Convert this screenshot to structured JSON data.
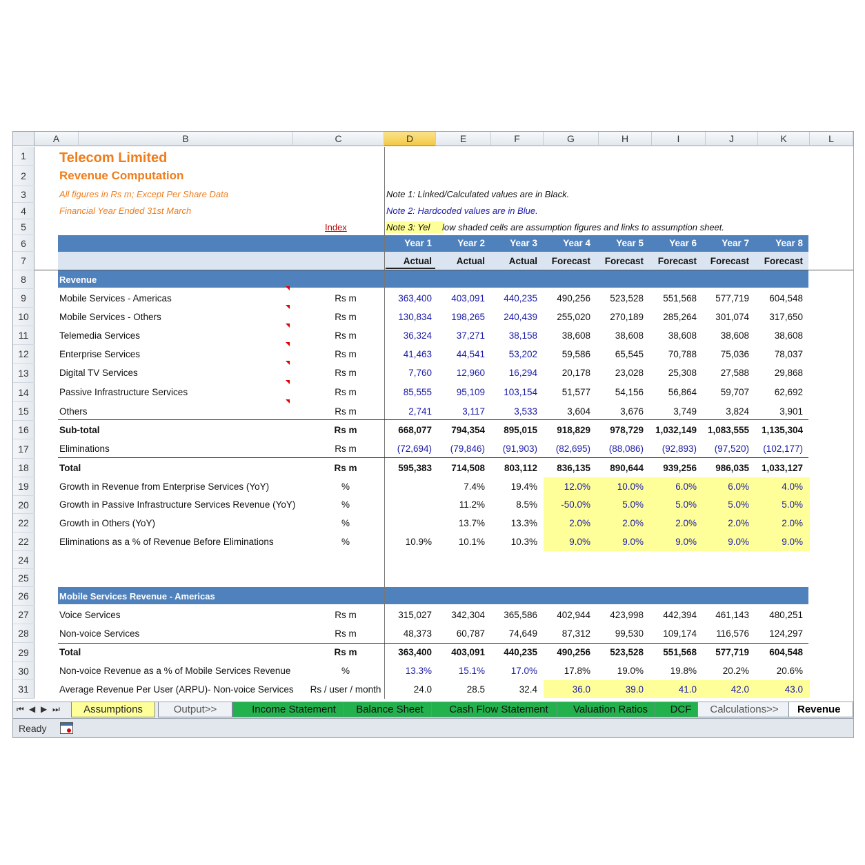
{
  "columns": [
    "A",
    "B",
    "C",
    "D",
    "E",
    "F",
    "G",
    "H",
    "I",
    "J",
    "K",
    "L"
  ],
  "selected_column": "D",
  "header": {
    "title": "Telecom Limited",
    "subtitle": "Revenue Computation",
    "units_note": "All figures in Rs m; Except Per Share Data",
    "fy_note": "Financial Year Ended 31st March",
    "index_link": "Index",
    "note1": "Note 1: Linked/Calculated values are in Black.",
    "note2": "Note 2: Hardcoded values are in Blue.",
    "note3_highlight": "Note 3: Yel",
    "note3_rest": "low shaded cells are assumption figures and links to assumption sheet."
  },
  "years": [
    "Year 1",
    "Year 2",
    "Year 3",
    "Year 4",
    "Year 5",
    "Year 6",
    "Year 7",
    "Year 8"
  ],
  "periods": [
    "Actual",
    "Actual",
    "Actual",
    "Forecast",
    "Forecast",
    "Forecast",
    "Forecast",
    "Forecast"
  ],
  "section1": {
    "title": "Revenue",
    "rows": [
      {
        "num": "9",
        "label": "Mobile Services - Americas",
        "unit": "Rs m",
        "values": [
          "363,400",
          "403,091",
          "440,235",
          "490,256",
          "523,528",
          "551,568",
          "577,719",
          "604,548"
        ]
      },
      {
        "num": "10",
        "label": "Mobile Services - Others",
        "unit": "Rs m",
        "values": [
          "130,834",
          "198,265",
          "240,439",
          "255,020",
          "270,189",
          "285,264",
          "301,074",
          "317,650"
        ]
      },
      {
        "num": "11",
        "label": "Telemedia Services",
        "unit": "Rs m",
        "values": [
          "36,324",
          "37,271",
          "38,158",
          "38,608",
          "38,608",
          "38,608",
          "38,608",
          "38,608"
        ]
      },
      {
        "num": "12",
        "label": "Enterprise Services",
        "unit": "Rs m",
        "values": [
          "41,463",
          "44,541",
          "53,202",
          "59,586",
          "65,545",
          "70,788",
          "75,036",
          "78,037"
        ]
      },
      {
        "num": "13",
        "label": "Digital TV Services",
        "unit": "Rs m",
        "values": [
          "7,760",
          "12,960",
          "16,294",
          "20,178",
          "23,028",
          "25,308",
          "27,588",
          "29,868"
        ]
      },
      {
        "num": "14",
        "label": "Passive Infrastructure Services",
        "unit": "Rs m",
        "values": [
          "85,555",
          "95,109",
          "103,154",
          "51,577",
          "54,156",
          "56,864",
          "59,707",
          "62,692"
        ]
      },
      {
        "num": "15",
        "label": "Others",
        "unit": "Rs m",
        "values": [
          "2,741",
          "3,117",
          "3,533",
          "3,604",
          "3,676",
          "3,749",
          "3,824",
          "3,901"
        ]
      }
    ],
    "subtotal": {
      "num": "16",
      "label": "Sub-total",
      "unit": "Rs m",
      "values": [
        "668,077",
        "794,354",
        "895,015",
        "918,829",
        "978,729",
        "1,032,149",
        "1,083,555",
        "1,135,304"
      ]
    },
    "eliminations": {
      "num": "17",
      "label": "Eliminations",
      "unit": "Rs m",
      "values": [
        "(72,694)",
        "(79,846)",
        "(91,903)",
        "(82,695)",
        "(88,086)",
        "(92,893)",
        "(97,520)",
        "(102,177)"
      ]
    },
    "total": {
      "num": "18",
      "label": "Total",
      "unit": "Rs m",
      "values": [
        "595,383",
        "714,508",
        "803,112",
        "836,135",
        "890,644",
        "939,256",
        "986,035",
        "1,033,127"
      ]
    },
    "ratios": [
      {
        "num": "19",
        "label": "Growth in Revenue from Enterprise Services (YoY)",
        "unit": "%",
        "values": [
          "",
          "7.4%",
          "19.4%",
          "12.0%",
          "10.0%",
          "6.0%",
          "6.0%",
          "4.0%"
        ]
      },
      {
        "num": "20",
        "label": "Growth in Passive Infrastructure Services Revenue (YoY)",
        "unit": "%",
        "values": [
          "",
          "11.2%",
          "8.5%",
          "-50.0%",
          "5.0%",
          "5.0%",
          "5.0%",
          "5.0%"
        ]
      },
      {
        "num": "22",
        "label": "Growth in Others (YoY)",
        "unit": "%",
        "values": [
          "",
          "13.7%",
          "13.3%",
          "2.0%",
          "2.0%",
          "2.0%",
          "2.0%",
          "2.0%"
        ]
      },
      {
        "num": "22",
        "label": "Eliminations as a % of Revenue Before Eliminations",
        "unit": "%",
        "values": [
          "10.9%",
          "10.1%",
          "10.3%",
          "9.0%",
          "9.0%",
          "9.0%",
          "9.0%",
          "9.0%"
        ]
      }
    ]
  },
  "blank_rows": [
    "24",
    "25"
  ],
  "section2": {
    "num": "26",
    "title": "Mobile Services Revenue - Americas",
    "rows": [
      {
        "num": "27",
        "label": "Voice Services",
        "unit": "Rs m",
        "values": [
          "315,027",
          "342,304",
          "365,586",
          "402,944",
          "423,998",
          "442,394",
          "461,143",
          "480,251"
        ]
      },
      {
        "num": "28",
        "label": "Non-voice Services",
        "unit": "Rs m",
        "values": [
          "48,373",
          "60,787",
          "74,649",
          "87,312",
          "99,530",
          "109,174",
          "116,576",
          "124,297"
        ]
      }
    ],
    "total": {
      "num": "29",
      "label": "Total",
      "unit": "Rs m",
      "values": [
        "363,400",
        "403,091",
        "440,235",
        "490,256",
        "523,528",
        "551,568",
        "577,719",
        "604,548"
      ]
    },
    "ratios": [
      {
        "num": "30",
        "label": "Non-voice Revenue as a % of Mobile Services Revenue",
        "unit": "%",
        "values": [
          "13.3%",
          "15.1%",
          "17.0%",
          "17.8%",
          "19.0%",
          "19.8%",
          "20.2%",
          "20.6%"
        ]
      },
      {
        "num": "31",
        "label": "Average Revenue Per User (ARPU)- Non-voice Services",
        "unit": "Rs / user / month",
        "values": [
          "24.0",
          "28.5",
          "32.4",
          "36.0",
          "39.0",
          "41.0",
          "42.0",
          "43.0"
        ]
      }
    ]
  },
  "tabs": [
    {
      "label": "Assumptions",
      "style": "yellow"
    },
    {
      "label": "Output>>",
      "style": "grey"
    },
    {
      "label": "Income Statement",
      "style": "green"
    },
    {
      "label": "Balance Sheet",
      "style": "green"
    },
    {
      "label": "Cash Flow Statement",
      "style": "green"
    },
    {
      "label": "Valuation Ratios",
      "style": "green"
    },
    {
      "label": "DCF",
      "style": "green"
    },
    {
      "label": "Calculations>>",
      "style": "grey"
    },
    {
      "label": "Revenue Co",
      "style": "active"
    }
  ],
  "status": {
    "ready": "Ready"
  },
  "colors": {
    "header_band": "#4f81bd",
    "light_band": "#dbe5f1",
    "assumption_fill": "#ffff99",
    "hardcoded_text": "#1a1aa8",
    "title_text": "#f07d1a",
    "tab_green": "#22b14c"
  }
}
